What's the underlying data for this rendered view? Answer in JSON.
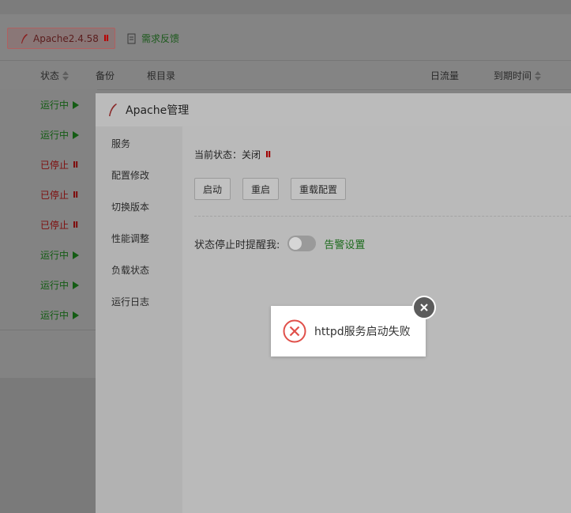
{
  "toolbar": {
    "apache_button_label": "Apache2.4.58",
    "apache_button_status": "II",
    "feedback_label": "需求反馈"
  },
  "table": {
    "headers": {
      "status": "状态",
      "backup": "备份",
      "root": "根目录",
      "traffic": "日流量",
      "expire": "到期时间"
    },
    "rows": [
      {
        "status": "运行中",
        "state": "running"
      },
      {
        "status": "运行中",
        "state": "running"
      },
      {
        "status": "已停止",
        "state": "stopped"
      },
      {
        "status": "已停止",
        "state": "stopped"
      },
      {
        "status": "已停止",
        "state": "stopped"
      },
      {
        "status": "运行中",
        "state": "running"
      },
      {
        "status": "运行中",
        "state": "running"
      },
      {
        "status": "运行中",
        "state": "running"
      }
    ]
  },
  "modal": {
    "title": "Apache管理",
    "sidebar": [
      "服务",
      "配置修改",
      "切换版本",
      "性能调整",
      "负载状态",
      "运行日志"
    ],
    "current_status_label": "当前状态：关闭",
    "current_status_icon": "II",
    "buttons": {
      "start": "启动",
      "restart": "重启",
      "reload": "重载配置"
    },
    "alarm_label": "状态停止时提醒我:",
    "alarm_toggle_on": false,
    "alarm_settings": "告警设置"
  },
  "toast": {
    "message": "httpd服务启动失败",
    "icon": "error-circle-icon"
  },
  "colors": {
    "running": "#135c13",
    "stopped": "#7e0d0d",
    "link_green": "#1c6b1c",
    "error_red": "#e0504a"
  }
}
